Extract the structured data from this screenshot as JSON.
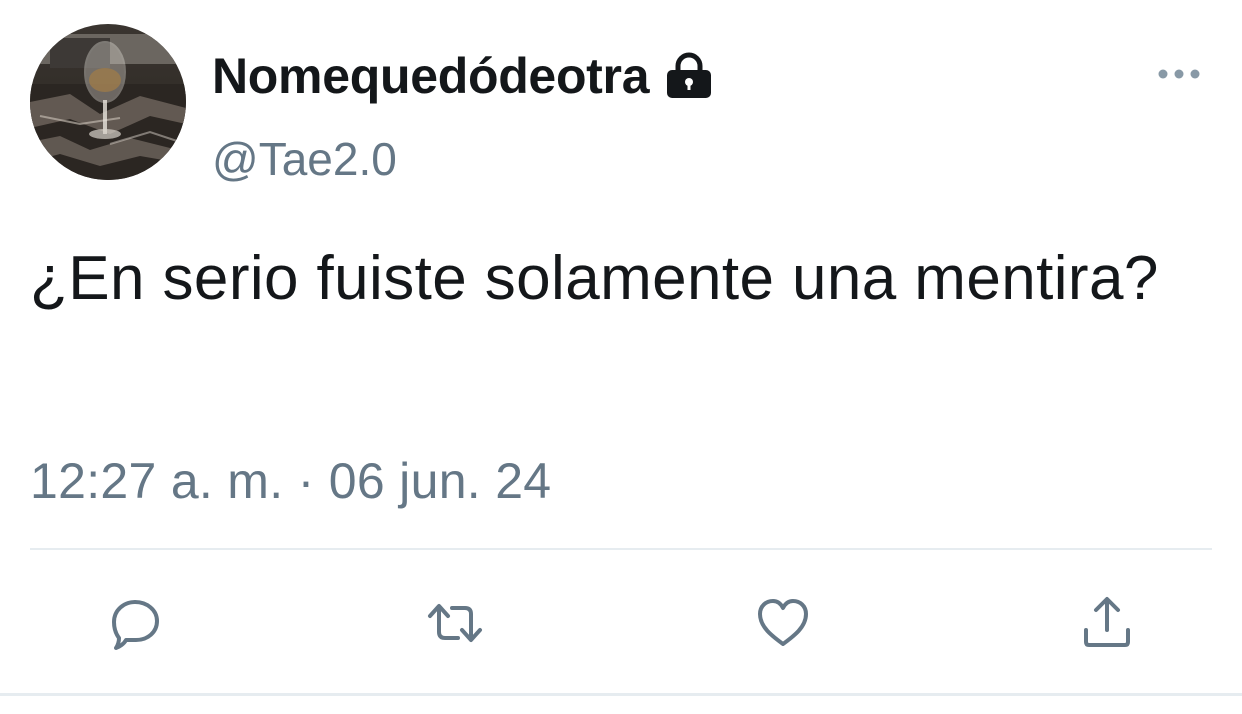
{
  "author": {
    "display_name": "Nomequedódeotra",
    "handle": "@Tae2.0",
    "avatar_icon": "wine-glass-photo",
    "protected_icon": "lock-icon"
  },
  "tweet": {
    "text": "¿En serio fuiste solamente una mentira?",
    "timestamp": "12:27 a. m. · 06 jun. 24"
  },
  "actions": {
    "reply_icon": "reply-icon",
    "retweet_icon": "retweet-icon",
    "like_icon": "heart-icon",
    "share_icon": "share-icon",
    "more_icon": "more-options-icon"
  },
  "colors": {
    "text": "#14171a",
    "secondary": "#657786",
    "divider": "#e6ecf0"
  }
}
